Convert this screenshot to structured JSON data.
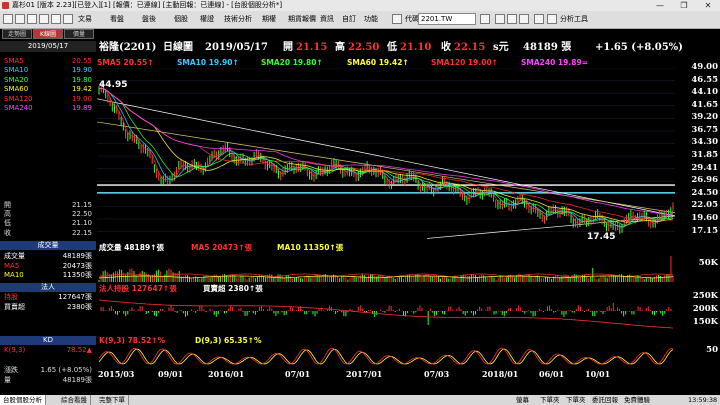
{
  "window": {
    "title": "嘉杉01 [版本 2.23][已登入][1] [報價：已連線] [主動回報：已連線] - [台股個股分析*]",
    "minimize_label": "—",
    "maximize_label": "❐",
    "close_label": "✕"
  },
  "toolbar": {
    "menus": [
      "文易",
      "看盤",
      "盤後",
      "個股",
      "權證",
      "技術分析",
      "期權",
      "期貨報價",
      "資訊",
      "自訂",
      "功能"
    ],
    "search_label": "代碼",
    "symbol_value": "2201.TW",
    "analysis_tools_label": "分析工具"
  },
  "left_panel": {
    "tabs": [
      "走勢圖",
      "K線圖",
      "價量"
    ],
    "date": "2019/05/17",
    "sma": [
      {
        "label": "SMA5",
        "value": "20.55",
        "color": "#ff3030"
      },
      {
        "label": "SMA10",
        "value": "19.90",
        "color": "#33ccff"
      },
      {
        "label": "SMA20",
        "value": "19.80",
        "color": "#33ff33"
      },
      {
        "label": "SMA60",
        "value": "19.42",
        "color": "#ffff33"
      },
      {
        "label": "SMA120",
        "value": "19.00",
        "color": "#ff3030"
      },
      {
        "label": "SMA240",
        "value": "19.89",
        "color": "#ff44ff"
      }
    ],
    "ohlc": [
      {
        "label": "開",
        "value": "21.15"
      },
      {
        "label": "高",
        "value": "22.50"
      },
      {
        "label": "低",
        "value": "21.10"
      },
      {
        "label": "收",
        "value": "22.15"
      }
    ],
    "volume_title": "成交量",
    "volume": [
      {
        "label": "成交量",
        "value": "48189張",
        "color": "#ffffff"
      },
      {
        "label": "MA5",
        "value": "20473張",
        "color": "#ff3030"
      },
      {
        "label": "MA10",
        "value": "11350張",
        "color": "#ffff33"
      }
    ],
    "inst_title": "法人",
    "inst": [
      {
        "label": "持股",
        "value": "127647張",
        "color": "#ff3030"
      },
      {
        "label": "買賣超",
        "value": "2380張",
        "color": "#ffffff"
      }
    ],
    "kd_title": "KD",
    "kd": [
      {
        "label": "K(9,3)",
        "value": "78.52▲",
        "color": "#ff3030"
      }
    ],
    "change": [
      {
        "label": "漲跌",
        "value": "1.65 (+8.05%)"
      },
      {
        "label": "量",
        "value": "48189張"
      }
    ]
  },
  "header": {
    "name": "裕隆(2201)",
    "chart_type": "日線圖",
    "date": "2019/05/17",
    "open_label": "開",
    "open": "21.15",
    "high_label": "高",
    "high": "22.50",
    "low_label": "低",
    "low": "21.10",
    "close_label": "收",
    "close": "22.15",
    "unit": "s元",
    "volume": "48189 張",
    "change": "+1.65 (+8.05%)"
  },
  "sma_legend": [
    {
      "text": "SMA5 20.55↑",
      "color": "#ff3030"
    },
    {
      "text": "SMA10 19.90↑",
      "color": "#33ccff"
    },
    {
      "text": "SMA20 19.80↑",
      "color": "#33ff33"
    },
    {
      "text": "SMA60 19.42↑",
      "color": "#ffff33"
    },
    {
      "text": "SMA120 19.00↑",
      "color": "#ff3030"
    },
    {
      "text": "SMA240 19.89=",
      "color": "#ff44ff"
    }
  ],
  "price_annotations": {
    "max": "44.95",
    "min": "17.45"
  },
  "volume_legend": [
    {
      "text": "成交量 48189↑張",
      "color": "#ffffff"
    },
    {
      "text": "MA5 20473↑張",
      "color": "#ff3030"
    },
    {
      "text": "MA10 11350↑張",
      "color": "#ffff33"
    }
  ],
  "inst_legend": [
    {
      "text": "法人持股 127647↑張",
      "color": "#ff3030"
    },
    {
      "text": "買賣超 2380↑張",
      "color": "#ffffff"
    }
  ],
  "kd_legend": [
    {
      "text": "K(9,3) 78.52↑%",
      "color": "#ff3030"
    },
    {
      "text": "D(9,3) 65.35↑%",
      "color": "#ffff33"
    }
  ],
  "status_bar": {
    "tabs": [
      "台股個股分析",
      "綜合看盤",
      "完整下單"
    ],
    "right_items": [
      "螢幕",
      "下單夾",
      "下單夾",
      "委託回報",
      "免費體驗"
    ],
    "time": "13:59:38"
  },
  "chart_data": [
    {
      "type": "line",
      "title": "裕隆(2201) 日線圖",
      "x": [
        "2015/03",
        "09/01",
        "2016/01",
        "07/01",
        "2017/01",
        "07/03",
        "2018/01",
        "06/01",
        "10/01"
      ],
      "series": [
        {
          "name": "SMA5",
          "values": [
            44.95,
            27.5,
            32.5,
            29.0,
            29.2,
            26.6,
            24.2,
            21.0,
            18.6,
            20.55
          ]
        },
        {
          "name": "SMA240",
          "values": [
            42.0,
            36.5,
            33.0,
            31.0,
            29.5,
            27.5,
            25.5,
            23.0,
            21.0,
            19.89
          ]
        }
      ],
      "y_ticks": [
        49.0,
        46.55,
        44.1,
        41.65,
        39.2,
        36.75,
        34.3,
        31.85,
        29.41,
        26.96,
        24.5,
        22.05,
        19.6,
        17.15
      ],
      "ylim": [
        15.5,
        49.0
      ],
      "max_label": 44.95,
      "min_label": 17.45
    },
    {
      "type": "bar",
      "title": "成交量",
      "y_ticks": [
        "50K",
        "0"
      ],
      "ylim": [
        0,
        60000
      ]
    },
    {
      "type": "line",
      "title": "法人",
      "y_ticks": [
        "250K",
        "200K",
        "150K"
      ],
      "ylim": [
        120000,
        270000
      ]
    },
    {
      "type": "line",
      "title": "KD",
      "y_ticks": [
        50
      ],
      "ylim": [
        0,
        100
      ],
      "series": [
        {
          "name": "K(9,3)",
          "values": [
            78.52
          ]
        },
        {
          "name": "D(9,3)",
          "values": [
            65.35
          ]
        }
      ]
    }
  ]
}
